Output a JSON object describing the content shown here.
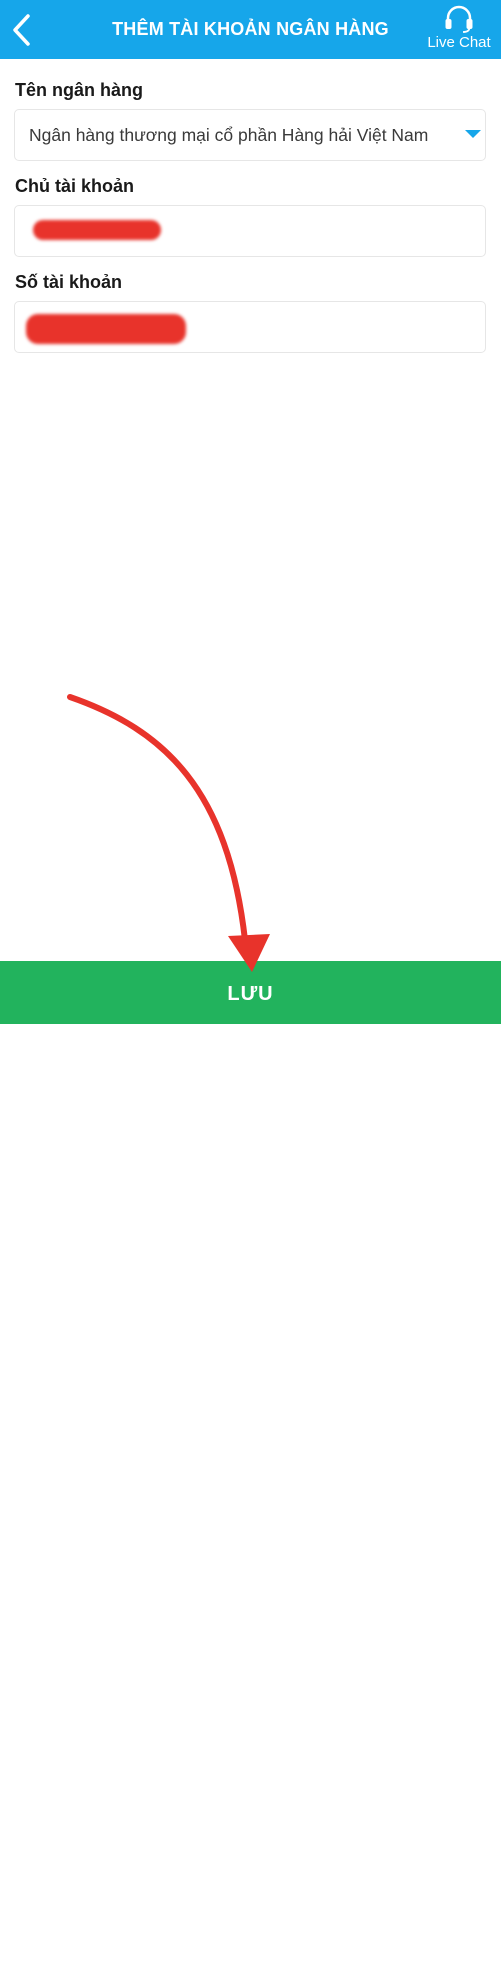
{
  "header": {
    "title": "THÊM TÀI KHOẢN NGÂN HÀNG",
    "live_chat_label": "Live Chat",
    "back_icon": "chevron-left-icon",
    "live_chat_icon": "headset-icon"
  },
  "form": {
    "bank_name": {
      "label": "Tên ngân hàng",
      "value": "Ngân hàng thương mại cổ phần Hàng hải Việt Nam"
    },
    "account_holder": {
      "label": "Chủ tài khoản"
    },
    "account_number": {
      "label": "Số tài khoản"
    }
  },
  "footer": {
    "save_label": "LƯU"
  },
  "colors": {
    "header_bg": "#16a6ea",
    "save_bg": "#22b35d",
    "annotation_red": "#e8332b"
  }
}
